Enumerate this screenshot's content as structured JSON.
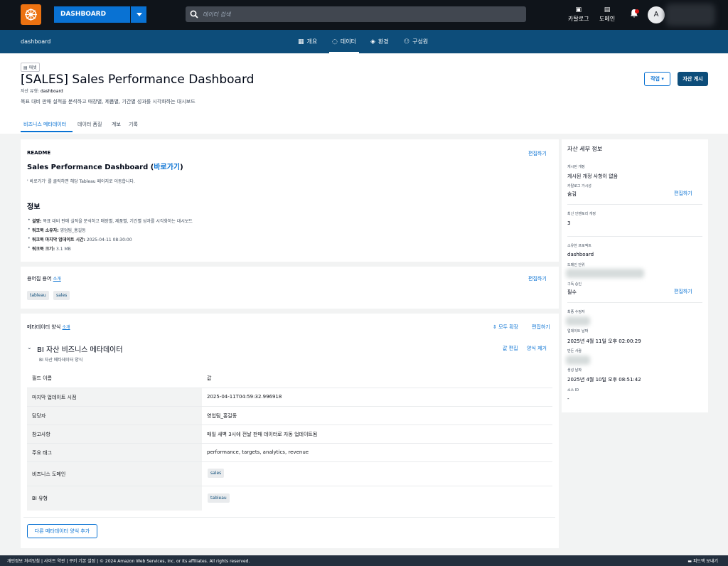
{
  "header": {
    "domain_label": "DASHBOARD",
    "search_placeholder": "데이터 검색",
    "catalog_label": "카탈로그",
    "domain_nav_label": "도메인",
    "avatar_initial": "A"
  },
  "subnav": {
    "project": "dashboard",
    "tabs": [
      {
        "label": "개요",
        "icon": "overview-icon"
      },
      {
        "label": "데이터",
        "icon": "data-icon"
      },
      {
        "label": "환경",
        "icon": "environment-icon"
      },
      {
        "label": "구성원",
        "icon": "members-icon"
      }
    ]
  },
  "page": {
    "breadcrumb": "애셋",
    "title": "[SALES] Sales Performance Dashboard",
    "asset_type_label": "자산 유형:",
    "asset_type_value": "dashboard",
    "description": "목표 대비 판매 실적을 분석하고 매장별, 제품별, 기간별 성과를 시각화하는 대시보드",
    "action_label": "작업",
    "publish_label": "자산 게시",
    "tabs": [
      "비즈니스 메타데이터",
      "데이터 품질",
      "계보",
      "기록"
    ]
  },
  "readme": {
    "label": "README",
    "edit": "편집하기",
    "heading": "Sales Performance Dashboard (",
    "heading_link": "바로가기",
    "heading_end": ")",
    "note": "' 바로가기' 를 클릭하면 해당 Tableau 페이지로 이동합니다.",
    "info_heading": "정보",
    "info": [
      {
        "key": "설명:",
        "value": " 목표 대비 판매 실적을 분석하고 매장별, 제품별, 기간별 성과를 시각화하는 대시보드"
      },
      {
        "key": "워크북 소유자:",
        "value": " 영업팀_홍길동"
      },
      {
        "key": "워크북 마지막 업데이트 시간:",
        "value": " 2025-04-11 08:30:00"
      },
      {
        "key": "워크북 크기:",
        "value": " 3.1 MB"
      }
    ]
  },
  "glossary": {
    "label": "용어집 용어",
    "intro": "소개",
    "edit": "편집하기",
    "tags": [
      "tableau",
      "sales"
    ]
  },
  "metadata_form": {
    "label": "메타데이터 양식",
    "intro": "소개",
    "expand_all": "모두 확장",
    "edit": "편집하기",
    "form_title": "BI 자산 비즈니스 메타데이터",
    "form_subtitle": "BI 자산 메타데이터 양식",
    "edit_values": "값 편집",
    "remove_form": "양식 제거",
    "col_field": "필드 이름",
    "col_value": "값",
    "rows": [
      {
        "field": "마지막 업데이트 시점",
        "value": "2025-04-11T04:59:32.996918"
      },
      {
        "field": "담당자",
        "value": "영업팀_홍길동"
      },
      {
        "field": "참고사항",
        "value": "매일 새벽 3시에 전날 판매 데이터로 자동 업데이트됨"
      },
      {
        "field": "주요 태그",
        "value": "performance, targets, analytics, revenue"
      },
      {
        "field": "비즈니스 도메인",
        "value": "sales"
      },
      {
        "field": "BI 유형",
        "value": "tableau"
      }
    ],
    "add_form": "다른 메타데이터 양식 추가"
  },
  "details": {
    "title": "자산 세부 정보",
    "published_revision_label": "게시된 개정",
    "published_revision_value": "게시된 개정 사항이 없음",
    "catalog_visibility_label": "카탈로그 가시성",
    "catalog_visibility_value": "숨김",
    "edit": "편집하기",
    "latest_inventory_label": "최신 인벤토리 개정",
    "latest_inventory_value": "3",
    "owning_project_label": "소유한 프로젝트",
    "owning_project_value": "dashboard",
    "domain_unit_label": "도메인 단위",
    "subscription_label": "구독 승인",
    "subscription_value": "필수",
    "last_modifier_label": "최종 수정자",
    "updated_date_label": "업데이트 날짜",
    "updated_date_value": "2025년 4월 11일 오후 02:00:29",
    "creator_label": "만든 사람",
    "created_date_label": "생성 날짜",
    "created_date_value": "2025년 4월 10일 오후 08:51:42",
    "source_id_label": "소스 ID",
    "source_id_value": "-"
  },
  "footer": {
    "left": "개인정보 처리방침  |  사이트 약관  |  쿠키 기본 설정  |  © 2024 Amazon Web Services, Inc. or its affiliates. All rights reserved.",
    "right": "피드백 보내기"
  },
  "colors": {
    "accent": "#0972d3",
    "nav": "#0d4d7a",
    "header": "#0f141a",
    "logo": "#ec7211"
  }
}
